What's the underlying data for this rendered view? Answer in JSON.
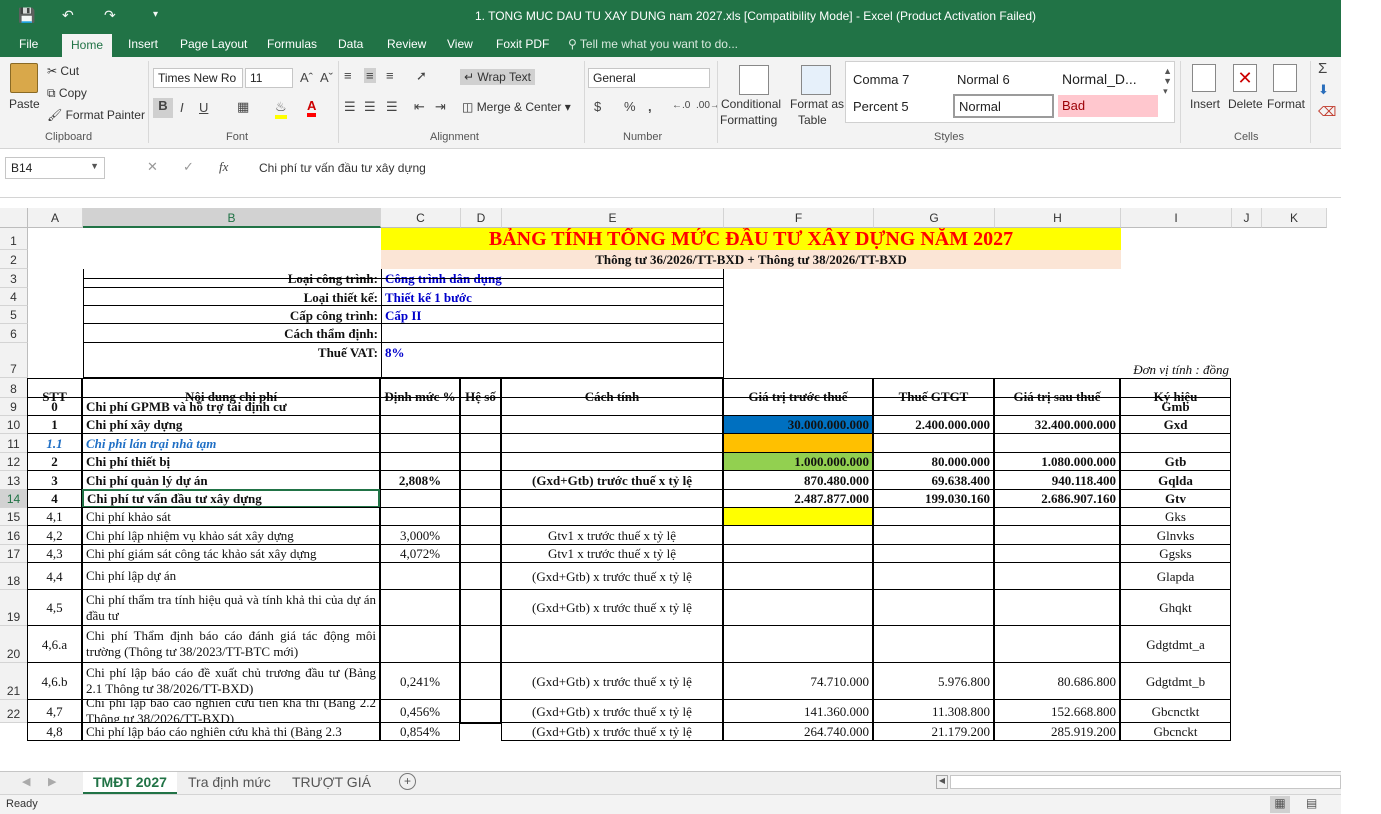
{
  "titlebar": {
    "title": "1. TONG MUC DAU TU XAY DUNG nam 2027.xls  [Compatibility Mode] - Excel (Product Activation Failed)"
  },
  "tabs": [
    "File",
    "Home",
    "Insert",
    "Page Layout",
    "Formulas",
    "Data",
    "Review",
    "View",
    "Foxit PDF"
  ],
  "tell_me": "Tell me what you want to do...",
  "ribbon": {
    "clipboard": {
      "paste": "Paste",
      "cut": "Cut",
      "copy": "Copy",
      "format_painter": "Format Painter",
      "label": "Clipboard"
    },
    "font": {
      "name": "Times New Ro",
      "size": "11",
      "label": "Font",
      "bold": "B",
      "italic": "I",
      "underline": "U"
    },
    "alignment": {
      "wrap_text": "Wrap Text",
      "merge_center": "Merge & Center",
      "label": "Alignment"
    },
    "number": {
      "format": "General",
      "label": "Number",
      "currency": "$",
      "percent": "%",
      "comma": ","
    },
    "styles": {
      "conditional_1": "Conditional",
      "conditional_2": "Formatting",
      "format_as_1": "Format as",
      "format_as_2": "Table",
      "cells": [
        "Comma 7",
        "Normal 6",
        "Normal_D...",
        "Percent 5",
        "Normal",
        "Bad"
      ],
      "label": "Styles"
    },
    "cells": {
      "insert": "Insert",
      "delete": "Delete",
      "format": "Format",
      "label": "Cells"
    }
  },
  "formula_bar": {
    "name_box": "B14",
    "fx": "fx",
    "content": "Chi phí tư vấn đầu tư xây dựng"
  },
  "columns": [
    "A",
    "B",
    "C",
    "D",
    "E",
    "F",
    "G",
    "H",
    "I",
    "J",
    "K"
  ],
  "rows": [
    "1",
    "2",
    "3",
    "4",
    "5",
    "6",
    "7",
    "8",
    "9",
    "10",
    "11",
    "12",
    "13",
    "14",
    "15",
    "16",
    "17",
    "18",
    "19",
    "20",
    "21",
    "22"
  ],
  "sheet": {
    "title": "BẢNG TÍNH TỔNG MỨC ĐẦU TƯ XÂY DỰNG NĂM 2027",
    "subtitle": "Thông tư 36/2026/TT-BXD + Thông tư 38/2026/TT-BXD",
    "info": [
      {
        "label": "Loại công trình:",
        "value": "Công trình dân dụng"
      },
      {
        "label": "Loại thiết kế:",
        "value": "Thiết kế 1 bước"
      },
      {
        "label": "Cấp công trình:",
        "value": "Cấp II"
      },
      {
        "label": "Cách thẩm định:",
        "value": ""
      },
      {
        "label": "Thuế VAT:",
        "value": "8%"
      }
    ],
    "unit": "Đơn vị tính : đồng",
    "headers": [
      "STT",
      "Nội dung chi phí",
      "Định mức %",
      "Hệ số",
      "Cách tính",
      "Giá trị trước thuế",
      "Thuế GTGT",
      "Giá trị sau thuế",
      "Ký hiệu"
    ],
    "rows": [
      {
        "stt": "0",
        "name": "Chi phí GPMB và hỗ trợ tái định cư",
        "rate": "",
        "coef": "",
        "method": "",
        "pre": "",
        "vat": "",
        "post": "",
        "code": "Gmb"
      },
      {
        "stt": "1",
        "name": "Chi phí xây dựng",
        "rate": "",
        "coef": "",
        "method": "",
        "pre": "30.000.000.000",
        "vat": "2.400.000.000",
        "post": "32.400.000.000",
        "code": "Gxd"
      },
      {
        "stt": "1.1",
        "name": "Chi phí lán trại nhà tạm",
        "rate": "",
        "coef": "",
        "method": "",
        "pre": "",
        "vat": "",
        "post": "",
        "code": ""
      },
      {
        "stt": "2",
        "name": "Chi phí thiết bị",
        "rate": "",
        "coef": "",
        "method": "",
        "pre": "1.000.000.000",
        "vat": "80.000.000",
        "post": "1.080.000.000",
        "code": "Gtb"
      },
      {
        "stt": "3",
        "name": "Chi phí quản lý dự án",
        "rate": "2,808%",
        "coef": "",
        "method": "(Gxd+Gtb) trước thuế x tỷ lệ",
        "pre": "870.480.000",
        "vat": "69.638.400",
        "post": "940.118.400",
        "code": "Gqlda"
      },
      {
        "stt": "4",
        "name": "Chi phí tư vấn đầu tư xây dựng",
        "rate": "",
        "coef": "",
        "method": "",
        "pre": "2.487.877.000",
        "vat": "199.030.160",
        "post": "2.686.907.160",
        "code": "Gtv"
      },
      {
        "stt": "4,1",
        "name": "Chi phí khảo sát",
        "rate": "",
        "coef": "",
        "method": "",
        "pre": "",
        "vat": "",
        "post": "",
        "code": "Gks"
      },
      {
        "stt": "4,2",
        "name": "Chi phí lập nhiệm vụ khảo sát xây dựng",
        "rate": "3,000%",
        "coef": "",
        "method": "Gtv1 x trước thuế x tỷ lệ",
        "pre": "",
        "vat": "",
        "post": "",
        "code": "Glnvks"
      },
      {
        "stt": "4,3",
        "name": "Chi phí giám sát công tác khảo sát xây dựng",
        "rate": "4,072%",
        "coef": "",
        "method": "Gtv1 x trước thuế x tỷ lệ",
        "pre": "",
        "vat": "",
        "post": "",
        "code": "Ggsks"
      },
      {
        "stt": "4,4",
        "name": "Chi phí lập dự án",
        "rate": "",
        "coef": "",
        "method": "(Gxd+Gtb) x trước thuế x tỷ lệ",
        "pre": "",
        "vat": "",
        "post": "",
        "code": "Glapda"
      },
      {
        "stt": "4,5",
        "name": "Chi phí thẩm tra tính hiệu quả và tính khả thi của dự án đầu tư",
        "rate": "",
        "coef": "",
        "method": "(Gxd+Gtb) x trước thuế x tỷ lệ",
        "pre": "",
        "vat": "",
        "post": "",
        "code": "Ghqkt"
      },
      {
        "stt": "4,6.a",
        "name": "Chi phí Thẩm định báo cáo đánh giá tác động môi trường (Thông tư 38/2023/TT-BTC mới)",
        "rate": "",
        "coef": "",
        "method": "",
        "pre": "",
        "vat": "",
        "post": "",
        "code": "Gdgtdmt_a"
      },
      {
        "stt": "4,6.b",
        "name": "Chi phí lập báo cáo đề xuất chủ trương đầu tư (Bảng 2.1 Thông tư 38/2026/TT-BXD)",
        "rate": "0,241%",
        "coef": "",
        "method": "(Gxd+Gtb) x trước thuế x tỷ lệ",
        "pre": "74.710.000",
        "vat": "5.976.800",
        "post": "80.686.800",
        "code": "Gdgtdmt_b"
      },
      {
        "stt": "4,7",
        "name": "Chi phí lập báo cáo nghiên cứu tiền khả thi (Bảng 2.2 Thông tư 38/2026/TT-BXD)",
        "rate": "0,456%",
        "coef": "",
        "method": "(Gxd+Gtb) x trước thuế x tỷ lệ",
        "pre": "141.360.000",
        "vat": "11.308.800",
        "post": "152.668.800",
        "code": "Gbcnctkt"
      },
      {
        "stt": "4,8",
        "name": "Chi phí lập báo cáo nghiên cứu khả thi (Bảng 2.3",
        "rate": "0,854%",
        "coef": "",
        "method": "(Gxd+Gtb) x trước thuế x tỷ lệ",
        "pre": "264.740.000",
        "vat": "21.179.200",
        "post": "285.919.200",
        "code": "Gbcnckt"
      }
    ]
  },
  "sheet_tabs": [
    "TMĐT 2027",
    "Tra định mức",
    "TRƯỢT GIÁ"
  ],
  "status": "Ready",
  "colors": {
    "excel_green": "#217346",
    "title_red": "#ff0000",
    "title_bg": "#ffff00",
    "subtitle_bg": "#fbe5d6",
    "blue_fill": "#0070c0",
    "orange_fill": "#ffc000",
    "green_fill": "#92d050",
    "yellow_fill": "#ffff00",
    "info_blue": "#0000cc"
  }
}
